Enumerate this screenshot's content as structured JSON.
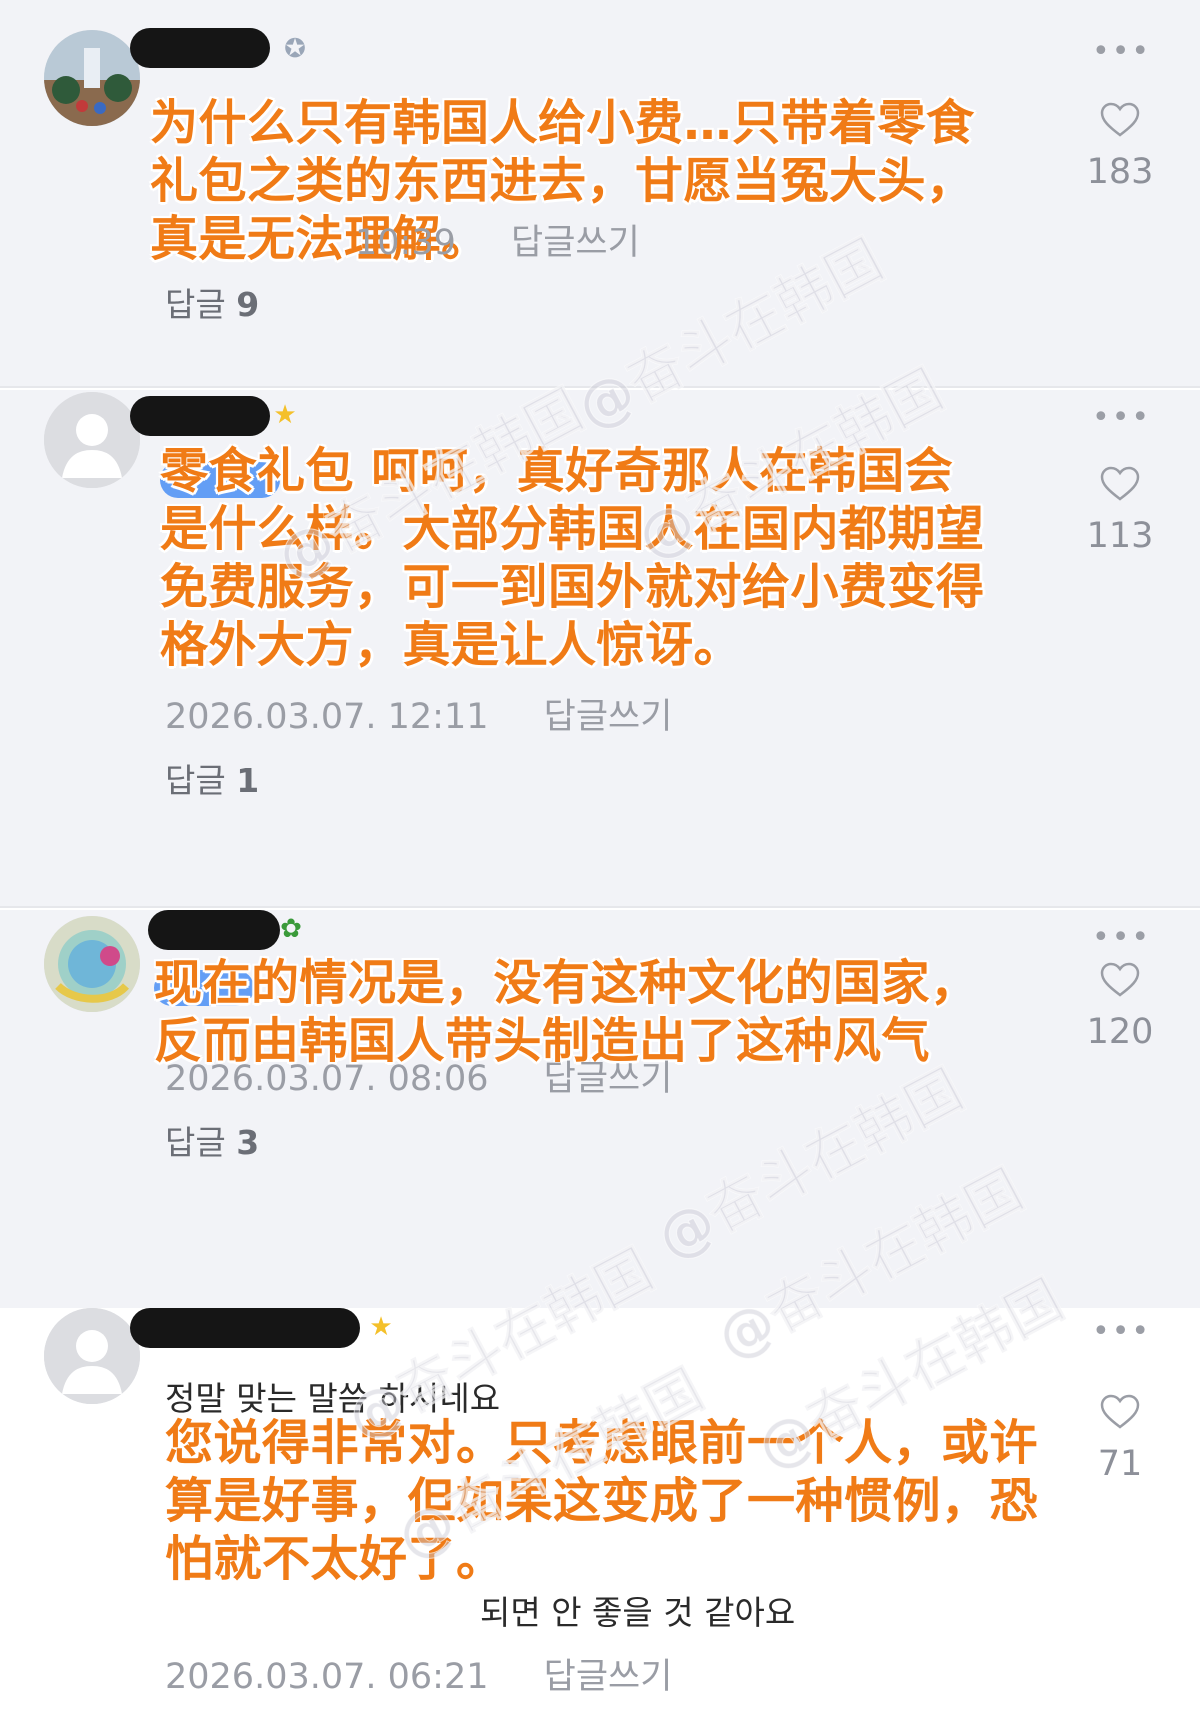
{
  "watermark": "@奋斗在韩国",
  "icons": {
    "more": "more-dots-icon",
    "like": "heart-outline-icon",
    "badge_medal": "medal-badge-icon",
    "badge_star": "star-badge-icon",
    "badge_sprout": "sprout-badge-icon"
  },
  "comments": [
    {
      "overlay_text": "为什么只有韩国人给小费…只带着零食礼包之类的东西进去，甘愿当冤大头，真是无法理解。",
      "date": "10:39",
      "reply_write": "답글쓰기",
      "reply_label": "답글",
      "reply_count": "9",
      "likes": "183"
    },
    {
      "overlay_text": "零食礼包 呵呵，真好奇那人在韩国会是什么样。大部分韩国人在国内都期望免费服务，可一到国外就对给小费变得格外大方，真是让人惊讶。",
      "date": "2026.03.07. 12:11",
      "reply_write": "답글쓰기",
      "reply_label": "답글",
      "reply_count": "1",
      "likes": "113"
    },
    {
      "overlay_text": "现在的情况是，没有这种文化的国家，反而由韩国人带头制造出了这种风气",
      "date": "2026.03.07. 08:06",
      "reply_write": "답글쓰기",
      "reply_label": "답글",
      "reply_count": "3",
      "likes": "120"
    },
    {
      "overlay_text": "您说得非常对。只考虑眼前一个人，或许算是好事，但如果这变成了一种惯例，恐怕就不太好了。",
      "korean_visible": "정말 맞는 말씀 하시네요",
      "korean_visible_tail": "되면 안 좋을 것 같아요",
      "date": "2026.03.07. 06:21",
      "reply_write": "답글쓰기",
      "likes": "71"
    }
  ]
}
